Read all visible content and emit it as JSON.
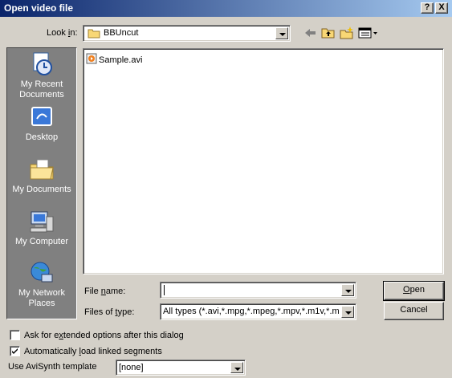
{
  "window": {
    "title": "Open video file",
    "help_btn": "?",
    "close_btn": "X"
  },
  "lookin": {
    "label_pre": "Look ",
    "label_ul": "i",
    "label_post": "n:",
    "value": "BBUncut"
  },
  "places": [
    {
      "label": "My Recent Documents",
      "icon": "recent-documents-icon"
    },
    {
      "label": "Desktop",
      "icon": "desktop-icon"
    },
    {
      "label": "My Documents",
      "icon": "my-documents-icon"
    },
    {
      "label": "My Computer",
      "icon": "my-computer-icon"
    },
    {
      "label": "My Network Places",
      "icon": "network-places-icon"
    }
  ],
  "files": [
    {
      "name": "Sample.avi",
      "icon": "avi-file-icon"
    }
  ],
  "filename": {
    "label_pre": "File ",
    "label_ul": "n",
    "label_post": "ame:",
    "value": ""
  },
  "filetype": {
    "label_pre": "Files of ",
    "label_ul": "t",
    "label_post": "ype:",
    "value": "All types (*.avi,*.mpg,*.mpeg,*.mpv,*.m1v,*.m2v"
  },
  "buttons": {
    "open_ul": "O",
    "open_post": "pen",
    "cancel": "Cancel"
  },
  "options": {
    "ask_extended_pre": "Ask for e",
    "ask_extended_ul": "x",
    "ask_extended_post": "tended options after this dialog",
    "ask_extended_checked": false,
    "auto_load_pre": "Automatically ",
    "auto_load_ul": "l",
    "auto_load_post": "oad linked segments",
    "auto_load_checked": true,
    "template_label": "Use AviSynth template",
    "template_value": "[none]"
  }
}
